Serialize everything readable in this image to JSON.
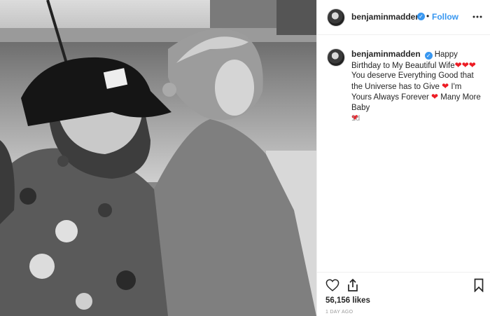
{
  "post": {
    "username": "benjaminmadden",
    "separator": "•",
    "follow_label": "Follow",
    "more_icon": "ellipsis-icon",
    "verified_icon": "verified-badge-icon"
  },
  "caption": {
    "username": "benjaminmadden",
    "part1": "Happy Birthday to My Beautiful Wife",
    "part2": "You deserve Everything Good that the Universe has to Give",
    "part3": "I'm Yours Always Forever",
    "part4": "Many More Baby",
    "heart": "❤",
    "age": "1d"
  },
  "actions": {
    "like_icon": "heart-icon",
    "share_icon": "share-icon",
    "save_icon": "bookmark-icon",
    "likes": "56,156 likes",
    "posted": "1 DAY AGO"
  },
  "colors": {
    "accent": "#3897f0",
    "heart": "#ed1c24",
    "text": "#262626",
    "muted": "#999999"
  }
}
